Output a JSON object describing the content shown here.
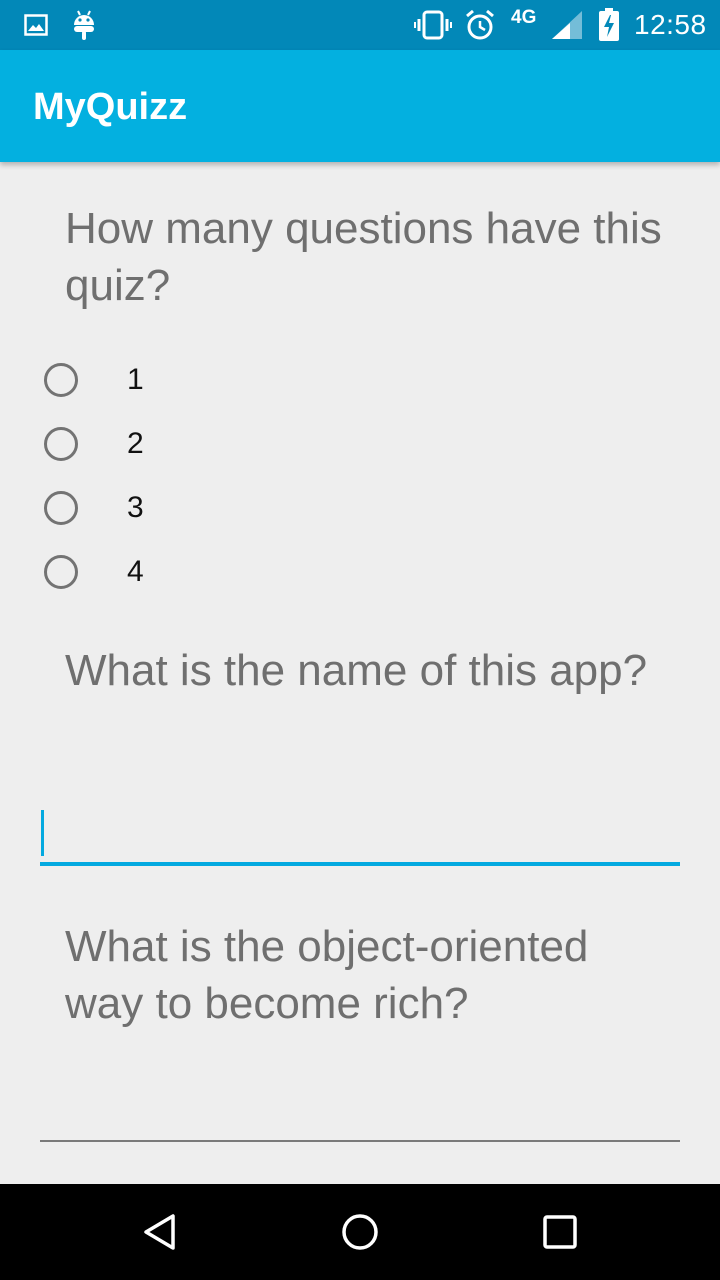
{
  "status_bar": {
    "left_icons": [
      "image-notification-icon",
      "android-notification-icon"
    ],
    "right_icons": [
      "vibrate-icon",
      "alarm-icon",
      "signal-icon",
      "battery-charging-icon"
    ],
    "network": "4G",
    "time": "12:58",
    "color": "#0288b8"
  },
  "app_bar": {
    "title": "MyQuizz",
    "color": "#03b0e0"
  },
  "questions": [
    {
      "text": "How many questions have this quiz?",
      "type": "radio",
      "options": [
        "1",
        "2",
        "3",
        "4"
      ]
    },
    {
      "text": "What is the name of this app?",
      "type": "text",
      "value": "",
      "focused": true
    },
    {
      "text": "What is the object-oriented way to become rich?",
      "type": "text",
      "value": "",
      "focused": false
    }
  ],
  "accent_color": "#03a9e0",
  "nav_bar": {
    "buttons": [
      "back-icon",
      "home-icon",
      "recents-icon"
    ]
  }
}
